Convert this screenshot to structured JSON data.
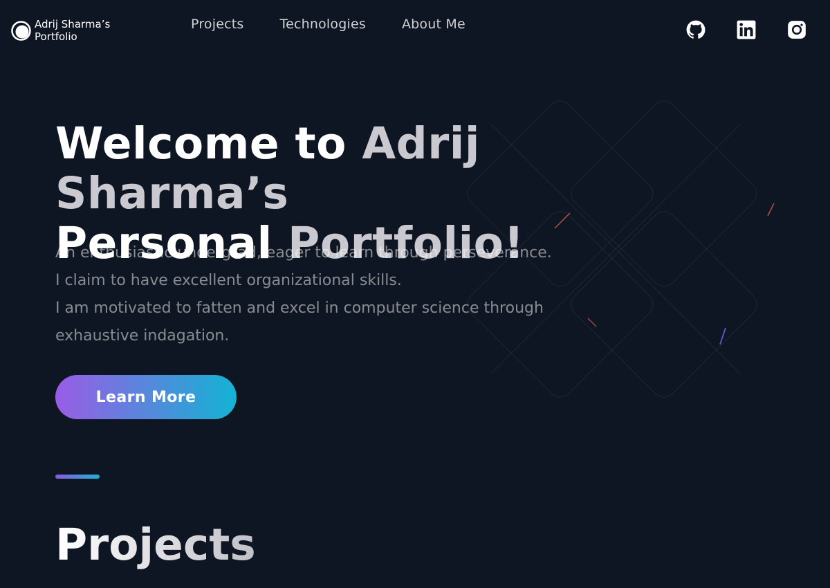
{
  "brand": {
    "line1": "Adrij Sharma’s",
    "line2": "Portfolio",
    "logo_icon": "circle-logo-icon"
  },
  "nav": {
    "links": [
      "Projects",
      "Technologies",
      "About Me"
    ]
  },
  "social": [
    {
      "icon": "github-icon"
    },
    {
      "icon": "linkedin-icon"
    },
    {
      "icon": "instagram-icon"
    }
  ],
  "hero": {
    "title_bright_1": "Welcome to ",
    "title_dim_1": "Adrij Sharma’s",
    "title_bright_2": "Personal ",
    "title_dim_2": "Portfolio!",
    "desc": [
      "An enthusiastic undergrad, eager to learn through perseverance.",
      "I claim to have excellent organizational skills.",
      "I am motivated to fatten and excel in computer science through exhaustive indagation."
    ],
    "cta_label": "Learn More"
  },
  "section": {
    "title": "Projects"
  },
  "colors": {
    "background": "#0f1623",
    "gradient_start": "#9a5ce6",
    "gradient_end": "#13b3d3"
  }
}
